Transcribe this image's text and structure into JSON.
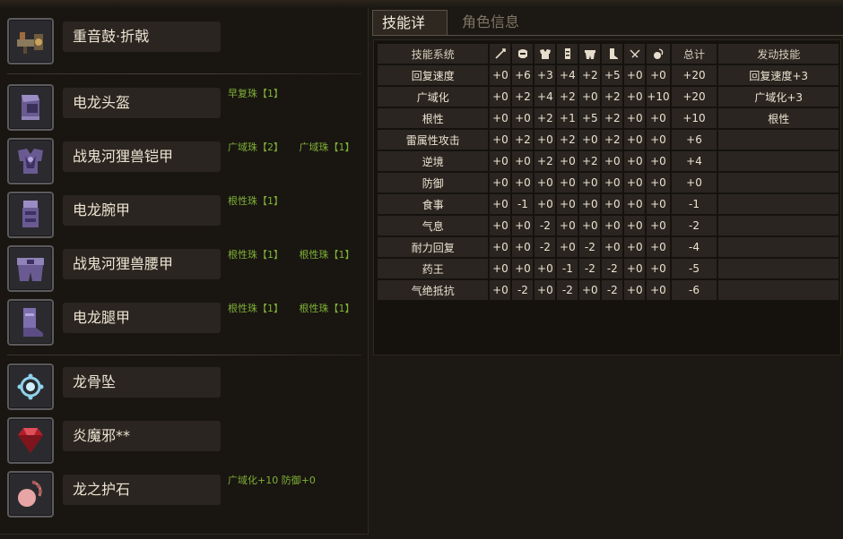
{
  "tabs": [
    {
      "label": "技能详情",
      "active": true
    },
    {
      "label": "角色信息",
      "active": false
    }
  ],
  "equipment": [
    {
      "slot": "weapon",
      "icon": "gunlance-icon",
      "name": "重音鼓·折戟",
      "gems": []
    },
    {
      "slot": "helm",
      "icon": "helm-icon",
      "name": "电龙头盔",
      "gems": [
        "早复珠【1】"
      ]
    },
    {
      "slot": "chest",
      "icon": "chest-armor-icon",
      "name": "战鬼河狸兽铠甲",
      "gems": [
        "广域珠【2】",
        "广域珠【1】"
      ]
    },
    {
      "slot": "arms",
      "icon": "arm-armor-icon",
      "name": "电龙腕甲",
      "gems": [
        "根性珠【1】"
      ]
    },
    {
      "slot": "waist",
      "icon": "waist-armor-icon",
      "name": "战鬼河狸兽腰甲",
      "gems": [
        "根性珠【1】",
        "根性珠【1】"
      ]
    },
    {
      "slot": "legs",
      "icon": "leg-armor-icon",
      "name": "电龙腿甲",
      "gems": [
        "根性珠【1】",
        "根性珠【1】"
      ]
    },
    {
      "slot": "charm",
      "icon": "charm-icon",
      "name": "龙骨坠",
      "gems": []
    },
    {
      "slot": "gem",
      "icon": "ruby-icon",
      "name": "炎魔邪**",
      "gems": []
    },
    {
      "slot": "talisman",
      "icon": "talisman-icon",
      "name": "龙之护石",
      "gems": [
        "广域化+10 防御+0"
      ]
    }
  ],
  "skill_table": {
    "headers": {
      "skill_system": "技能系统",
      "slot_icons": [
        "weapon-icon",
        "helm-icon",
        "chest-icon",
        "arm-icon",
        "waist-icon",
        "leg-icon",
        "charm-icon",
        "talisman-icon"
      ],
      "total": "总计",
      "active": "发动技能"
    },
    "rows": [
      {
        "name": "回复速度",
        "values": [
          "+0",
          "+6",
          "+3",
          "+4",
          "+2",
          "+5",
          "+0",
          "+0"
        ],
        "total": "+20",
        "active": "回复速度+3"
      },
      {
        "name": "广域化",
        "values": [
          "+0",
          "+2",
          "+4",
          "+2",
          "+0",
          "+2",
          "+0",
          "+10"
        ],
        "total": "+20",
        "active": "广域化+3"
      },
      {
        "name": "根性",
        "values": [
          "+0",
          "+0",
          "+2",
          "+1",
          "+5",
          "+2",
          "+0",
          "+0"
        ],
        "total": "+10",
        "active": "根性"
      },
      {
        "name": "雷属性攻击",
        "values": [
          "+0",
          "+2",
          "+0",
          "+2",
          "+0",
          "+2",
          "+0",
          "+0"
        ],
        "total": "+6",
        "active": ""
      },
      {
        "name": "逆境",
        "values": [
          "+0",
          "+0",
          "+2",
          "+0",
          "+2",
          "+0",
          "+0",
          "+0"
        ],
        "total": "+4",
        "active": ""
      },
      {
        "name": "防御",
        "values": [
          "+0",
          "+0",
          "+0",
          "+0",
          "+0",
          "+0",
          "+0",
          "+0"
        ],
        "total": "+0",
        "active": ""
      },
      {
        "name": "食事",
        "values": [
          "+0",
          "-1",
          "+0",
          "+0",
          "+0",
          "+0",
          "+0",
          "+0"
        ],
        "total": "-1",
        "active": ""
      },
      {
        "name": "气息",
        "values": [
          "+0",
          "+0",
          "-2",
          "+0",
          "+0",
          "+0",
          "+0",
          "+0"
        ],
        "total": "-2",
        "active": ""
      },
      {
        "name": "耐力回复",
        "values": [
          "+0",
          "+0",
          "-2",
          "+0",
          "-2",
          "+0",
          "+0",
          "+0"
        ],
        "total": "-4",
        "active": ""
      },
      {
        "name": "药王",
        "values": [
          "+0",
          "+0",
          "+0",
          "-1",
          "-2",
          "-2",
          "+0",
          "+0"
        ],
        "total": "-5",
        "active": ""
      },
      {
        "name": "气绝抵抗",
        "values": [
          "+0",
          "-2",
          "+0",
          "-2",
          "+0",
          "-2",
          "+0",
          "+0"
        ],
        "total": "-6",
        "active": ""
      }
    ]
  },
  "colors": {
    "gem_text": "#7fb236",
    "panel_bg": "#191511",
    "cell_bg": "#2a2520"
  }
}
